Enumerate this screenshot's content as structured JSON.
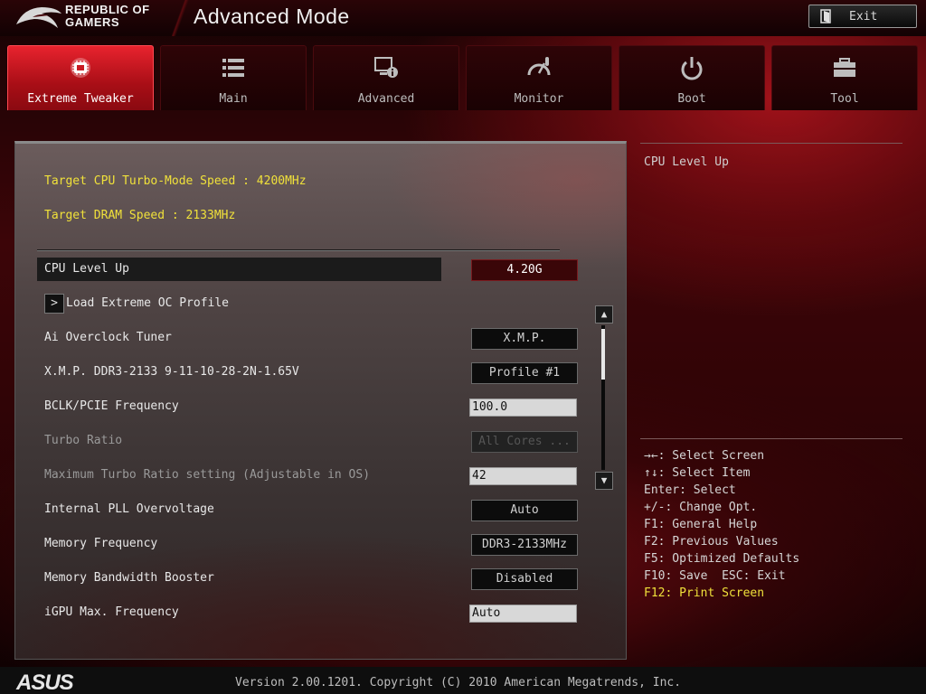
{
  "header": {
    "brand_line1": "REPUBLIC OF",
    "brand_line2": "GAMERS",
    "mode_title": "Advanced Mode",
    "exit_label": "Exit"
  },
  "tabs": [
    {
      "label": "Extreme Tweaker",
      "icon": "cpu-chip-icon",
      "active": true
    },
    {
      "label": "Main",
      "icon": "list-icon",
      "active": false
    },
    {
      "label": "Advanced",
      "icon": "advanced-settings-icon",
      "active": false
    },
    {
      "label": "Monitor",
      "icon": "gauge-icon",
      "active": false
    },
    {
      "label": "Boot",
      "icon": "power-icon",
      "active": false
    },
    {
      "label": "Tool",
      "icon": "toolbox-icon",
      "active": false
    }
  ],
  "info": {
    "cpu_speed": "Target CPU Turbo-Mode Speed : 4200MHz",
    "dram_speed": "Target DRAM Speed : 2133MHz"
  },
  "settings": [
    {
      "label": "CPU Level Up",
      "value": "4.20G",
      "kind": "select",
      "selected": true
    },
    {
      "label": "Load Extreme OC Profile",
      "value": "",
      "kind": "submenu"
    },
    {
      "label": "Ai Overclock Tuner",
      "value": "X.M.P.",
      "kind": "select"
    },
    {
      "label": "X.M.P. DDR3-2133 9-11-10-28-2N-1.65V",
      "value": "Profile #1",
      "kind": "select"
    },
    {
      "label": "BCLK/PCIE Frequency",
      "value": "100.0",
      "kind": "input"
    },
    {
      "label": "Turbo Ratio",
      "value": "All Cores ...",
      "kind": "select",
      "disabled": true
    },
    {
      "label": "Maximum Turbo Ratio setting (Adjustable in OS)",
      "value": "42",
      "kind": "input",
      "disabled": true
    },
    {
      "label": "Internal PLL Overvoltage",
      "value": "Auto",
      "kind": "select"
    },
    {
      "label": "Memory Frequency",
      "value": "DDR3-2133MHz",
      "kind": "select"
    },
    {
      "label": "Memory Bandwidth Booster",
      "value": "Disabled",
      "kind": "select"
    },
    {
      "label": "iGPU Max. Frequency",
      "value": "Auto",
      "kind": "input"
    }
  ],
  "help": {
    "title": "CPU Level Up",
    "keys": [
      "→←: Select Screen",
      "↑↓: Select Item",
      "Enter: Select",
      "+/-: Change Opt.",
      "F1: General Help",
      "F2: Previous Values",
      "F5: Optimized Defaults",
      "F10: Save  ESC: Exit"
    ],
    "highlight_key": "F12: Print Screen"
  },
  "footer": {
    "brand": "ASUS",
    "version": "Version 2.00.1201. Copyright (C) 2010 American Megatrends, Inc."
  },
  "colors": {
    "accent": "#e8232e",
    "highlight_text": "#f0e13a"
  }
}
